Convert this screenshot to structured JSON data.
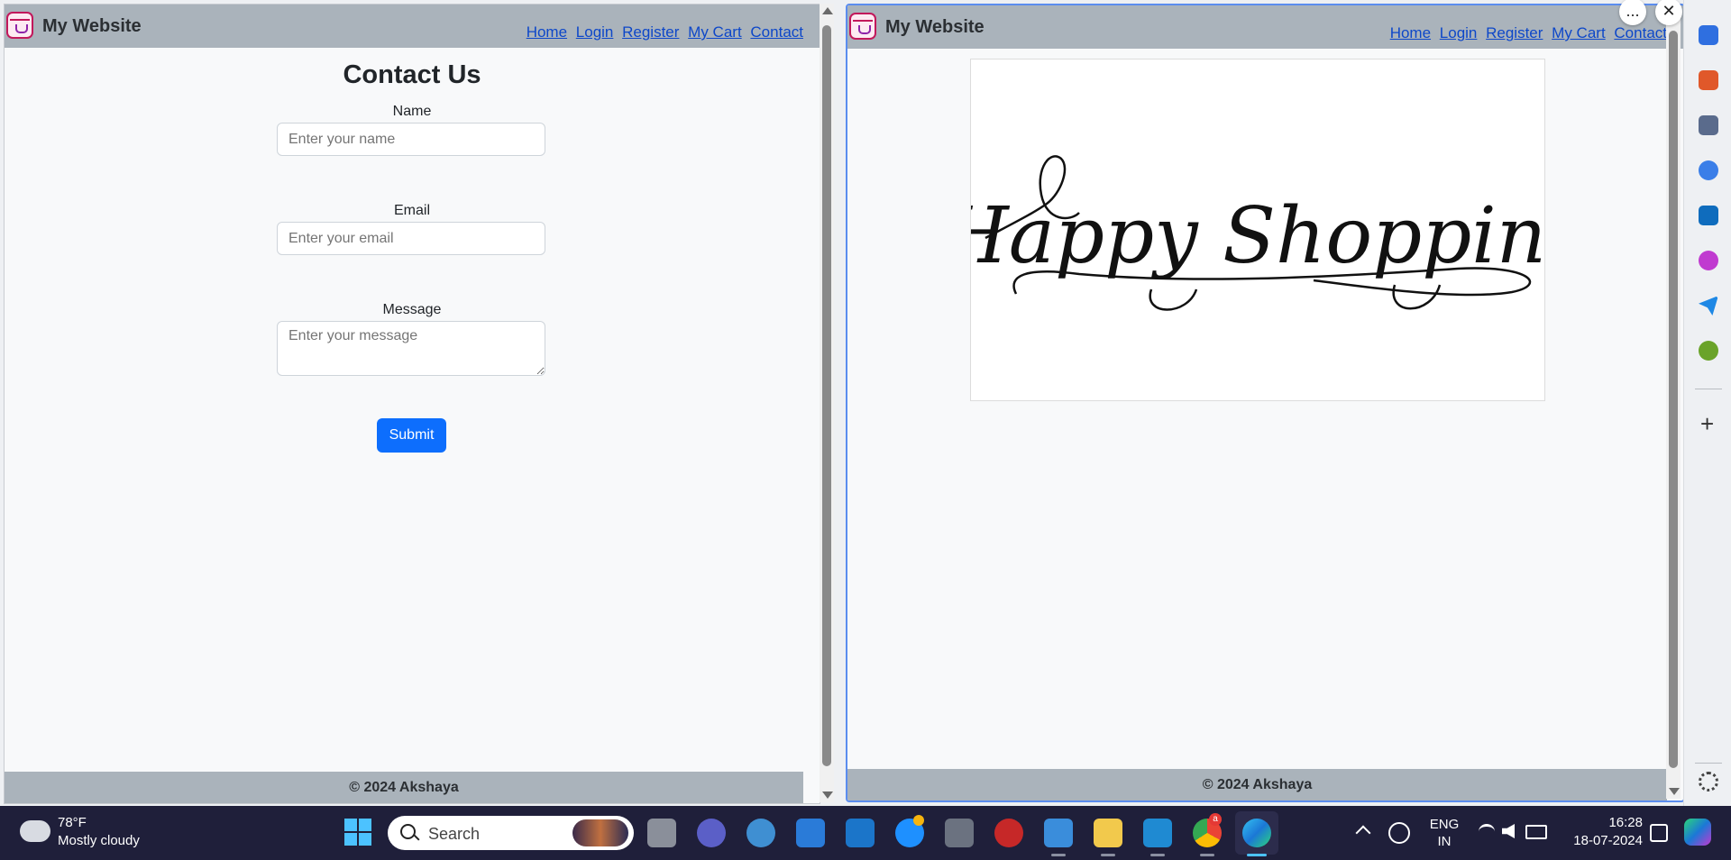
{
  "left_pane": {
    "brand": "My Website",
    "nav": [
      "Home",
      "Login",
      "Register",
      "My Cart",
      "Contact"
    ],
    "title": "Contact Us",
    "name_label": "Name",
    "name_placeholder": "Enter your name",
    "email_label": "Email",
    "email_placeholder": "Enter your email",
    "message_label": "Message",
    "message_placeholder": "Enter your message",
    "submit_label": "Submit",
    "footer": "© 2024 Akshaya"
  },
  "right_pane": {
    "brand": "My Website",
    "nav": [
      "Home",
      "Login",
      "Register",
      "My Cart",
      "Contact"
    ],
    "banner_text": "Happy Shopping",
    "footer": "© 2024 Akshaya",
    "more_button": "...",
    "close_button": "✕"
  },
  "edge_sidebar": {
    "icons": [
      "tag-icon",
      "toolbox-icon",
      "chess-icon",
      "copilot-icon",
      "outlook-icon",
      "designer-icon",
      "send-icon",
      "tree-icon"
    ],
    "add_button": "+"
  },
  "taskbar": {
    "weather_temp": "78°F",
    "weather_desc": "Mostly cloudy",
    "search_placeholder": "Search",
    "lang_top": "ENG",
    "lang_bottom": "IN",
    "time": "16:28",
    "date": "18-07-2024",
    "chrome_badge": "a"
  },
  "colors": {
    "navbar": "#aab3bb",
    "primary": "#0d6efd",
    "link": "#0d47c9",
    "taskbar": "#1f1f3a"
  }
}
